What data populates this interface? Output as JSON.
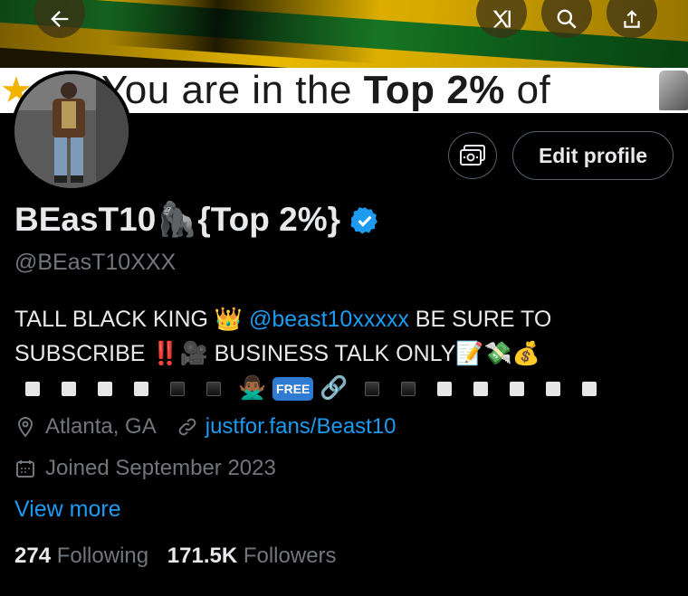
{
  "banner": {
    "text_pre": "You are in the ",
    "text_bold": "Top 2%",
    "text_post": " of"
  },
  "profile": {
    "display_name": "BEasT10🦍{Top 2%}",
    "handle": "@BEasT10XXX",
    "edit_label": "Edit profile",
    "bio_line1_pre": "TALL BLACK KING 👑 ",
    "bio_mention": "@beast10xxxxx",
    "bio_line1_post": " BE SURE TO",
    "bio_line2": "SUBSCRIBE ‼️🎥 BUSINESS TALK ONLY📝💸💰",
    "bio_free_badge": "FREE",
    "location": "Atlanta, GA",
    "website": "justfor.fans/Beast10",
    "joined": "Joined September 2023",
    "view_more": "View more",
    "following_count": "274",
    "following_label": "Following",
    "followers_count": "171.5K",
    "followers_label": "Followers"
  },
  "icons": {
    "back": "arrow-left-icon",
    "grok": "grok-icon",
    "search": "search-icon",
    "share": "share-icon",
    "monetize": "money-icon",
    "verified": "verified-badge-icon",
    "location": "location-pin-icon",
    "link": "link-icon",
    "calendar": "calendar-icon"
  },
  "colors": {
    "accent": "#1d9bf0",
    "secondary_text": "#71767b",
    "primary_text": "#e7e9ea",
    "border": "#536471"
  }
}
